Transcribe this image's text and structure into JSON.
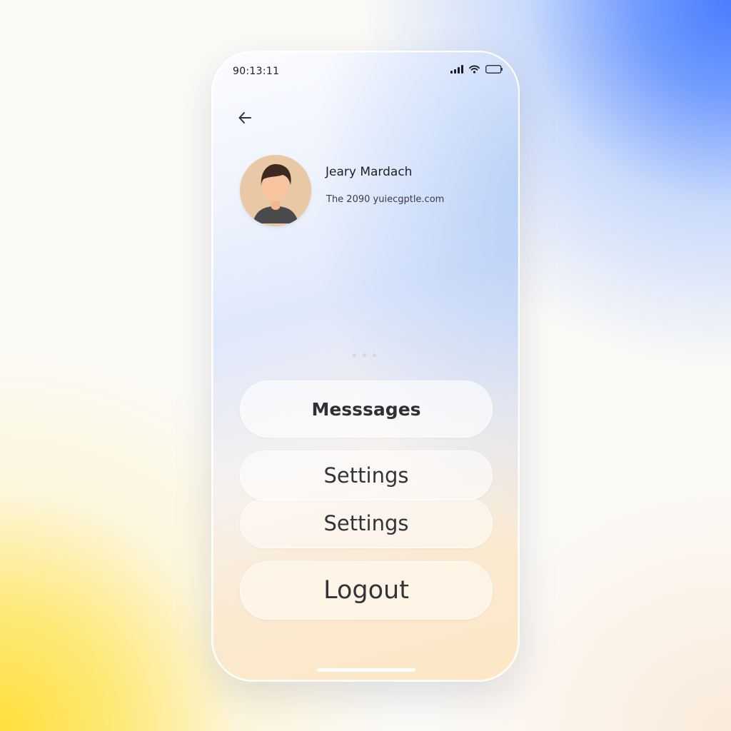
{
  "status_bar": {
    "time": "90:13:11",
    "icons": [
      "signal-icon",
      "wifi-icon",
      "battery-icon"
    ]
  },
  "navigation": {
    "back_icon": "arrow-left-icon"
  },
  "profile": {
    "name": "Jeary Mardach",
    "email": "The 2090 yuiecgptle.com",
    "avatar_icon": "user-avatar"
  },
  "pager": {
    "dot_count": 3
  },
  "menu": {
    "messages_label": "Messsages",
    "settings_label_1": "Settings",
    "settings_label_2": "Settings",
    "logout_label": "Logout"
  },
  "colors": {
    "background_blue": "#4a7cff",
    "background_yellow": "#ffdf3a",
    "text_primary": "#1f1f26",
    "button_text": "#33333a"
  }
}
